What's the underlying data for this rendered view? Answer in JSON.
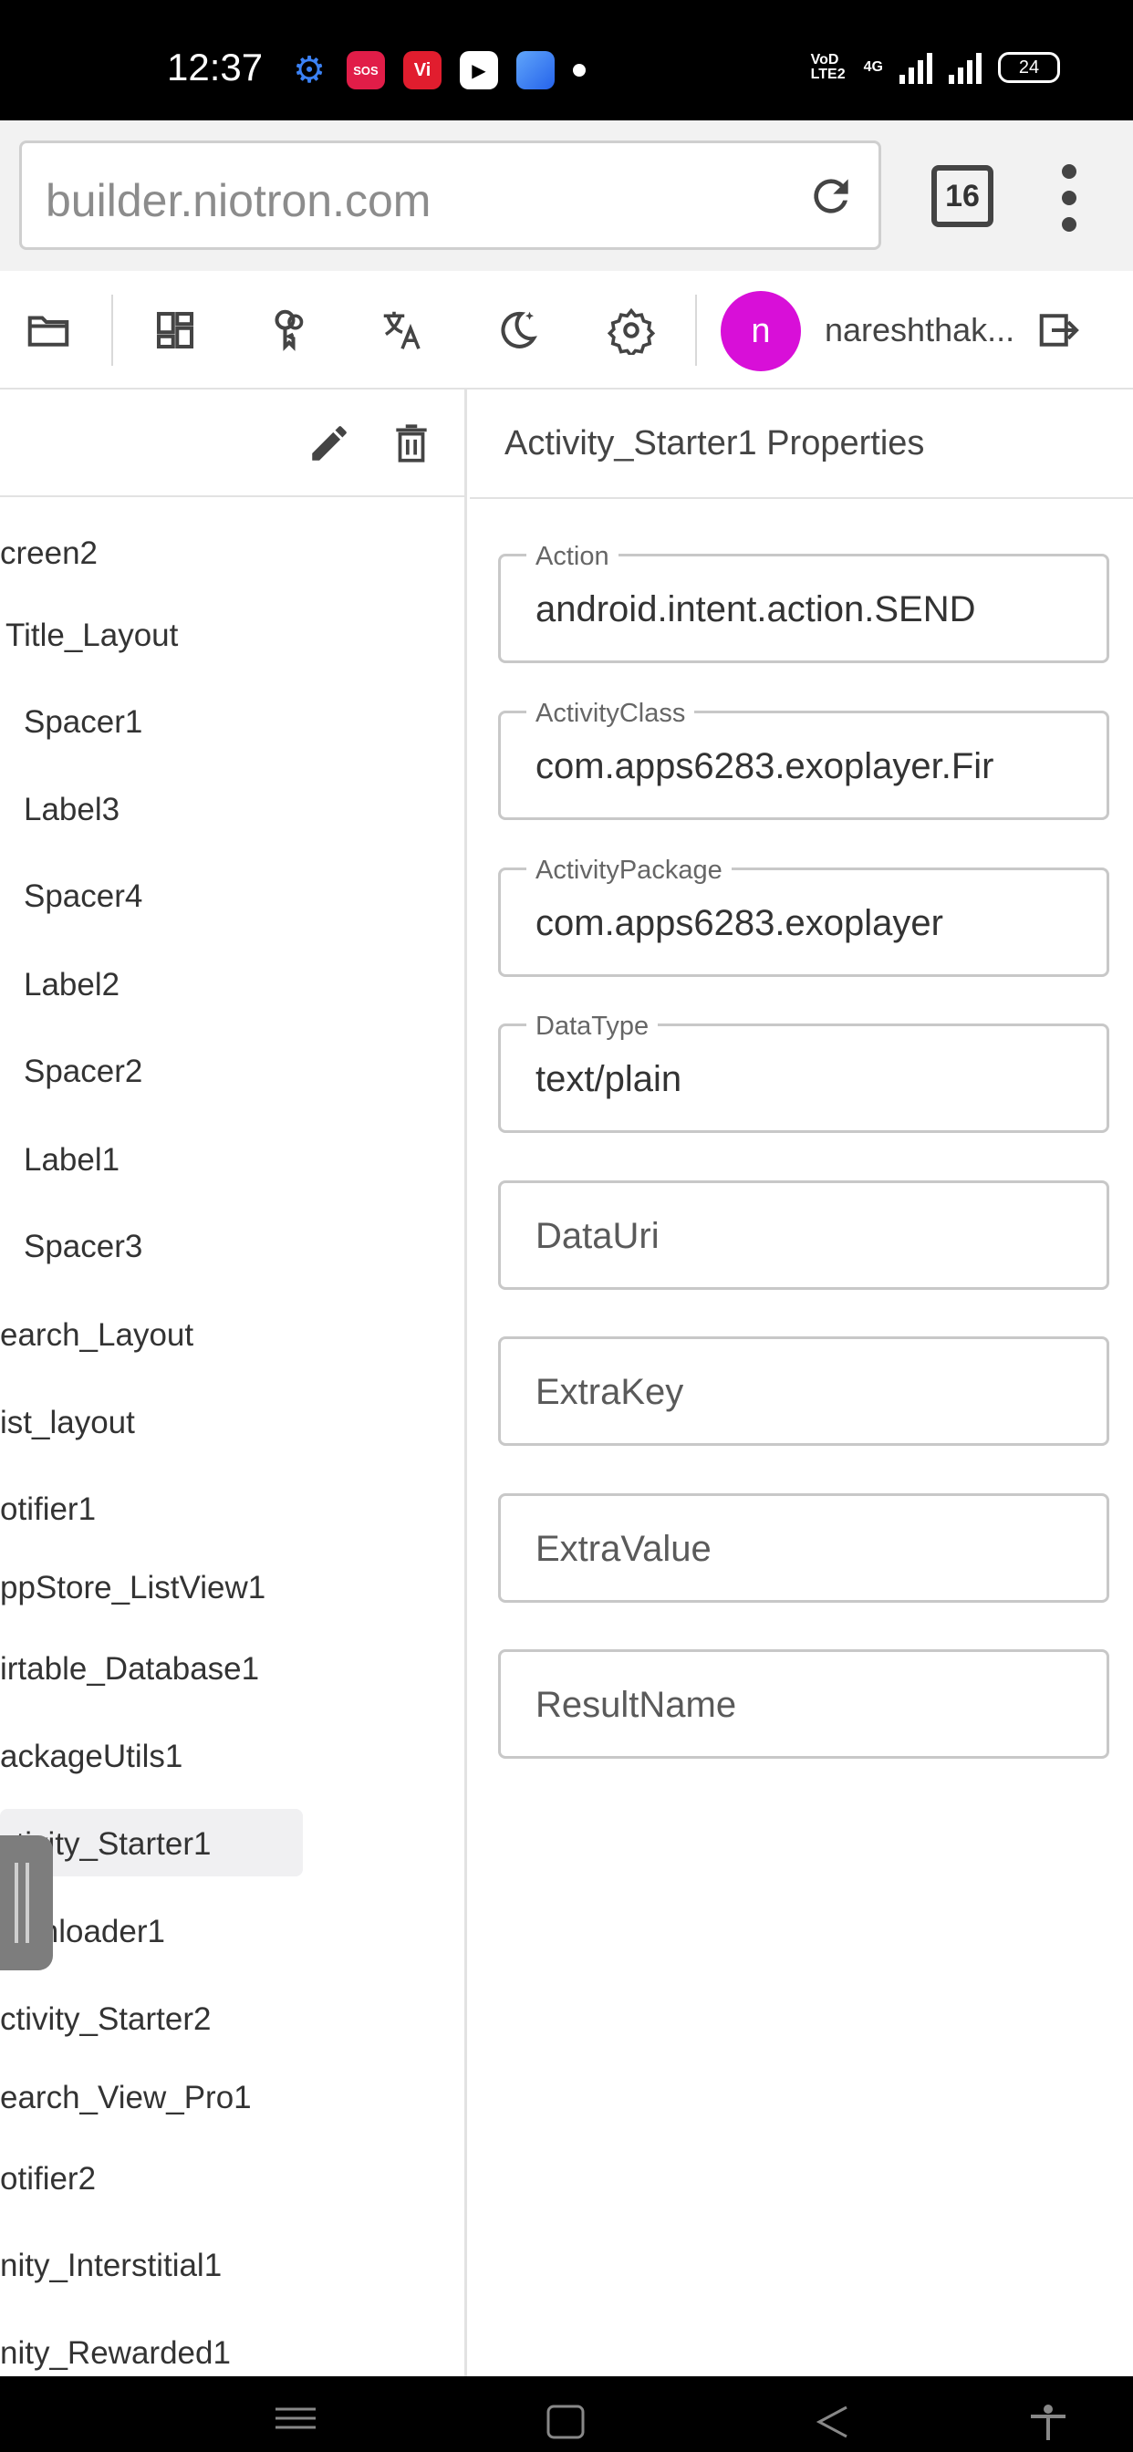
{
  "status_bar": {
    "time": "12:37",
    "network_label_1": "VoD LTE2",
    "network_label_2": "4G",
    "battery": "24",
    "icons": [
      "settings-icon",
      "sos-icon",
      "vi-icon",
      "youtube-icon",
      "app-icon",
      "dot-icon"
    ]
  },
  "browser": {
    "url": "builder.niotron.com",
    "tabs_count": "16"
  },
  "toolbar": {
    "icons": [
      "folder-icon",
      "dashboard-icon",
      "keys-icon",
      "translate-icon",
      "dark-mode-icon",
      "settings-icon"
    ],
    "avatar_letter": "n",
    "username": "nareshthak...",
    "avatar_color": "#d80fd8"
  },
  "components": {
    "items": [
      {
        "label": "creen2"
      },
      {
        "label": "Title_Layout"
      },
      {
        "label": "Spacer1"
      },
      {
        "label": "Label3"
      },
      {
        "label": "Spacer4"
      },
      {
        "label": "Label2"
      },
      {
        "label": "Spacer2"
      },
      {
        "label": "Label1"
      },
      {
        "label": "Spacer3"
      },
      {
        "label": "earch_Layout"
      },
      {
        "label": "ist_layout"
      },
      {
        "label": "otifier1"
      },
      {
        "label": "ppStore_ListView1"
      },
      {
        "label": "irtable_Database1"
      },
      {
        "label": "ackageUtils1"
      },
      {
        "label": "ctivity_Starter1"
      },
      {
        "label": "ownloader1"
      },
      {
        "label": "ctivity_Starter2"
      },
      {
        "label": "earch_View_Pro1"
      },
      {
        "label": "otifier2"
      },
      {
        "label": "nity_Interstitial1"
      },
      {
        "label": "nity_Rewarded1"
      }
    ]
  },
  "properties": {
    "title": "Activity_Starter1 Properties",
    "fields": [
      {
        "label": "Action",
        "value": "android.intent.action.SEND"
      },
      {
        "label": "ActivityClass",
        "value": "com.apps6283.exoplayer.Fir"
      },
      {
        "label": "ActivityPackage",
        "value": "com.apps6283.exoplayer"
      },
      {
        "label": "DataType",
        "value": "text/plain"
      },
      {
        "placeholder": "DataUri"
      },
      {
        "placeholder": "ExtraKey"
      },
      {
        "placeholder": "ExtraValue"
      },
      {
        "placeholder": "ResultName"
      }
    ]
  }
}
